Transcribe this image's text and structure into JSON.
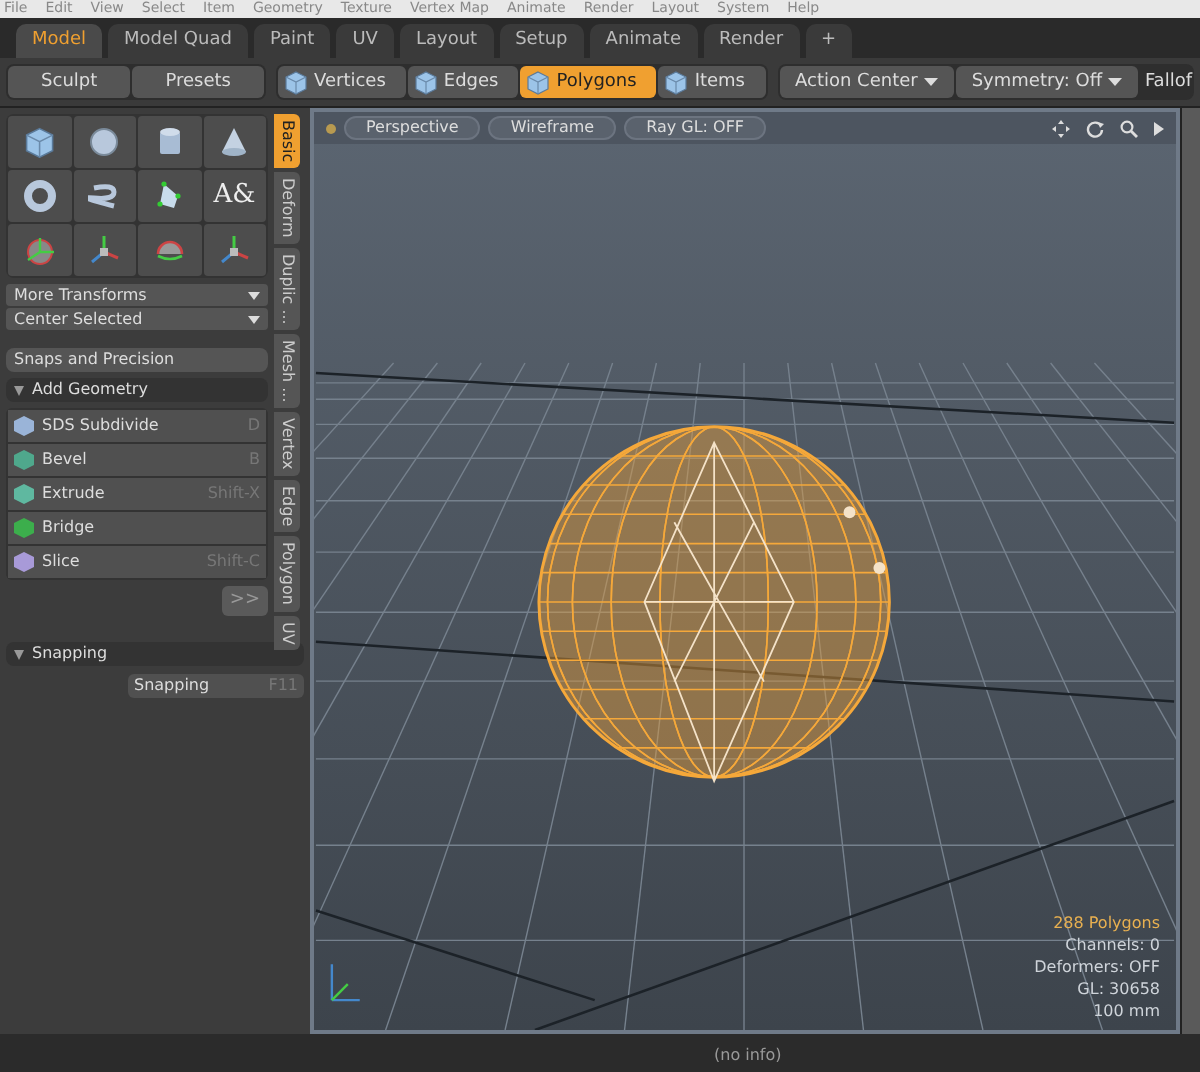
{
  "menu_bar": [
    "File",
    "Edit",
    "View",
    "Select",
    "Item",
    "Geometry",
    "Texture",
    "Vertex Map",
    "Animate",
    "Render",
    "Layout",
    "System",
    "Help"
  ],
  "tabs": [
    {
      "label": "Model",
      "selected": true
    },
    {
      "label": "Model Quad",
      "selected": false
    },
    {
      "label": "Paint",
      "selected": false
    },
    {
      "label": "UV",
      "selected": false
    },
    {
      "label": "Layout",
      "selected": false
    },
    {
      "label": "Setup",
      "selected": false
    },
    {
      "label": "Animate",
      "selected": false
    },
    {
      "label": "Render",
      "selected": false
    },
    {
      "label": "+",
      "selected": false
    }
  ],
  "toolbar": {
    "left_buttons": [
      "Sculpt",
      "Presets"
    ],
    "modes": [
      {
        "label": "Vertices",
        "selected": false
      },
      {
        "label": "Edges",
        "selected": false
      },
      {
        "label": "Polygons",
        "selected": true
      },
      {
        "label": "Items",
        "selected": false
      }
    ],
    "dropdowns": [
      "Action Center",
      "Symmetry: Off"
    ],
    "cut_label": "Fallof"
  },
  "left_panel": {
    "tool_icons": [
      {
        "kind": "cube"
      },
      {
        "kind": "sphere"
      },
      {
        "kind": "cylinder"
      },
      {
        "kind": "cone"
      },
      {
        "kind": "torus"
      },
      {
        "kind": "spiral"
      },
      {
        "kind": "pen"
      },
      {
        "kind": "text",
        "glyph": "A&"
      },
      {
        "kind": "gizmo"
      },
      {
        "kind": "axes"
      },
      {
        "kind": "rotate"
      },
      {
        "kind": "axes"
      }
    ],
    "dropdowns": [
      "More Transforms",
      "Center Selected"
    ],
    "snaps_button": "Snaps and Precision",
    "add_geometry": {
      "title": "Add Geometry",
      "expanded": true,
      "items": [
        {
          "label": "SDS Subdivide",
          "shortcut": "D",
          "color": "#9ab4d8"
        },
        {
          "label": "Bevel",
          "shortcut": "B",
          "color": "#4fa88c"
        },
        {
          "label": "Extrude",
          "shortcut": "Shift-X",
          "color": "#5fb8a0"
        },
        {
          "label": "Bridge",
          "color": "#3cae4c"
        },
        {
          "label": "Slice",
          "shortcut": "Shift-C",
          "color": "#a89ad8"
        }
      ]
    },
    "more_button": ">>",
    "snapping": {
      "title": "Snapping",
      "expanded": true,
      "items": [
        {
          "label": "Snapping",
          "shortcut": "F11"
        }
      ]
    }
  },
  "side_tabs": [
    {
      "label": "Basic",
      "selected": true
    },
    {
      "label": "Deform",
      "selected": false
    },
    {
      "label": "Duplic ...",
      "selected": false
    },
    {
      "label": "Mesh ...",
      "selected": false
    },
    {
      "label": "Vertex",
      "selected": false
    },
    {
      "label": "Edge",
      "selected": false
    },
    {
      "label": "Polygon",
      "selected": false
    },
    {
      "label": "UV",
      "selected": false
    }
  ],
  "viewport": {
    "buttons": [
      "Perspective",
      "Wireframe",
      "Ray GL: OFF"
    ],
    "info": [
      {
        "text": "288 Polygons",
        "kind": "highlight"
      },
      {
        "text": "Channels: 0",
        "kind": "normal"
      },
      {
        "text": "Deformers: OFF",
        "kind": "normal"
      },
      {
        "text": "GL: 30658",
        "kind": "normal"
      },
      {
        "text": "100 mm",
        "kind": "normal"
      }
    ]
  },
  "status_bar": "(no info)"
}
